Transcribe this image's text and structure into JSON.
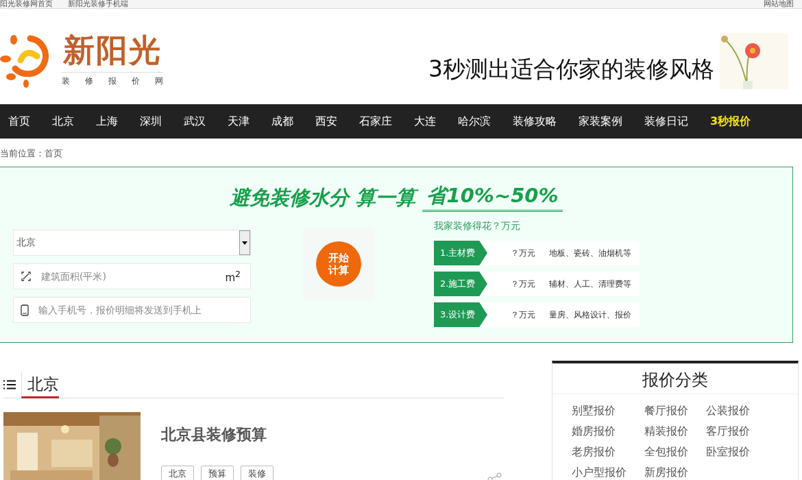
{
  "top_bar": {
    "links": [
      "阳光装修网首页",
      "新阳光装修手机端"
    ],
    "sitemap": "网站地图"
  },
  "header": {
    "logo": {
      "name": "新阳光",
      "tagline": [
        "装",
        "修",
        "报",
        "价",
        "网"
      ]
    },
    "slogan": "3秒测出适合你家的装修风格"
  },
  "nav": [
    {
      "label": "首页",
      "highlight": false
    },
    {
      "label": "北京",
      "highlight": false
    },
    {
      "label": "上海",
      "highlight": false
    },
    {
      "label": "深圳",
      "highlight": false
    },
    {
      "label": "武汉",
      "highlight": false
    },
    {
      "label": "天津",
      "highlight": false
    },
    {
      "label": "成都",
      "highlight": false
    },
    {
      "label": "西安",
      "highlight": false
    },
    {
      "label": "石家庄",
      "highlight": false
    },
    {
      "label": "大连",
      "highlight": false
    },
    {
      "label": "哈尔滨",
      "highlight": false
    },
    {
      "label": "装修攻略",
      "highlight": false
    },
    {
      "label": "家装案例",
      "highlight": false
    },
    {
      "label": "装修日记",
      "highlight": false
    },
    {
      "label": "3秒报价",
      "highlight": true
    }
  ],
  "breadcrumb": "当前位置：首页",
  "calculator": {
    "headline": "避免装修水分 算一算",
    "headline_emphasis": "省10%~50%",
    "city": {
      "value": "北京"
    },
    "area": {
      "placeholder": "建筑面积(平米)",
      "unit": "m$^{2}$"
    },
    "phone": {
      "placeholder": "输入手机号，报价明细将发送到手机上"
    },
    "start_button": [
      "开始",
      "计算"
    ],
    "estimate_title": "我家装修得花？万元",
    "costs": [
      {
        "label": "1.主材费",
        "amount": "？万元",
        "detail": "地板、瓷砖、油烟机等"
      },
      {
        "label": "2.施工费",
        "amount": "？万元",
        "detail": "辅材、人工、清理费等"
      },
      {
        "label": "3.设计费",
        "amount": "？万元",
        "detail": "量房、风格设计、报价"
      }
    ]
  },
  "section": {
    "title": "北京",
    "article": {
      "kind": "picture",
      "title": "北京县装修预算",
      "tags": [
        "北京",
        "预算",
        "装修"
      ]
    }
  },
  "sidebar": {
    "title": "报价分类",
    "items": [
      "别墅报价",
      "餐厅报价",
      "公装报价",
      "婚房报价",
      "精装报价",
      "客厅报价",
      "老房报价",
      "全包报价",
      "卧室报价",
      "小户型报价",
      "新房报价"
    ]
  }
}
